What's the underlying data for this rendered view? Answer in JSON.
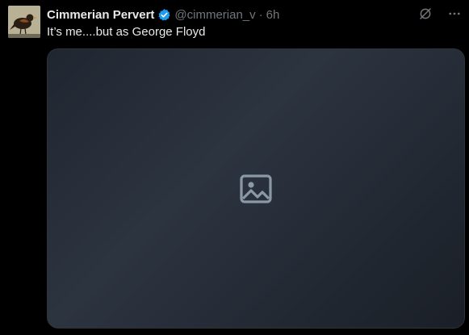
{
  "post": {
    "display_name": "Cimmerian Pervert",
    "handle": "@cimmerian_v",
    "separator": "·",
    "time": "6h",
    "text": "It’s me....but as George Floyd",
    "verified": true
  },
  "icons": {
    "avatar": "bird-avatar",
    "verified": "verified-badge-icon",
    "grok": "grok-icon",
    "more": "more-icon"
  },
  "colors": {
    "background": "#000000",
    "primary_text": "#e7e9ea",
    "secondary_text": "#71767b",
    "verified_blue": "#1d9bf0",
    "border": "#2f3336"
  }
}
